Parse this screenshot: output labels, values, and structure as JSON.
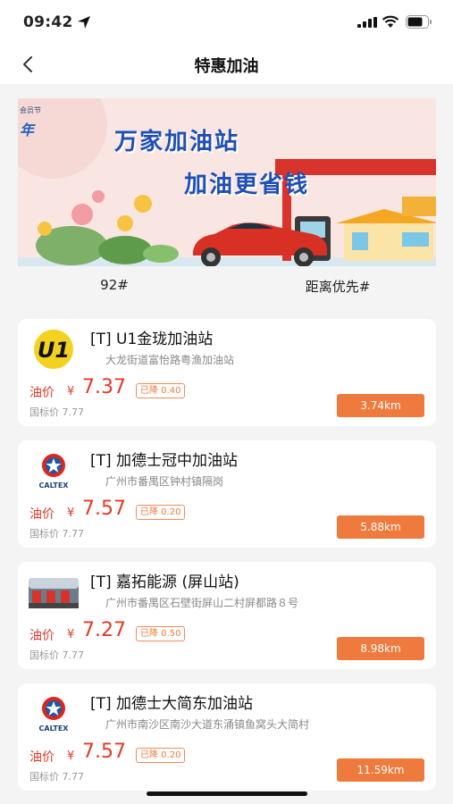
{
  "status_bar": {
    "time": "09:42"
  },
  "nav": {
    "title": "特惠加油"
  },
  "banner": {
    "corner_text": "会员节",
    "corner_mark": "年",
    "line1": "万家加油站",
    "line2": "加油更省钱"
  },
  "filters": {
    "fuel_type": "92#",
    "sort": "距离优先#"
  },
  "labels": {
    "price_label": "油价",
    "currency": "¥"
  },
  "stations": [
    {
      "name": "[T] U1金珑加油站",
      "address": "大龙街道富怡路粤渔加油站",
      "price": "7.37",
      "drop": "已降 0.40",
      "std_price": "国标价 7.77",
      "distance": "3.74km",
      "logo": "u1-logo"
    },
    {
      "name": "[T] 加德士冠中加油站",
      "address": "广州市番禺区钟村镇隔岗",
      "price": "7.57",
      "drop": "已降 0.20",
      "std_price": "国标价 7.77",
      "distance": "5.88km",
      "logo": "caltex-logo"
    },
    {
      "name": "[T] 嘉拓能源 (屏山站)",
      "address": "广州市番禺区石壁街屏山二村屏都路８号",
      "price": "7.27",
      "drop": "已降 0.50",
      "std_price": "国标价 7.77",
      "distance": "8.98km",
      "logo": "station-photo"
    },
    {
      "name": "[T] 加德士大简东加油站",
      "address": "广州市南沙区南沙大道东涌镇鱼窝头大简村",
      "price": "7.57",
      "drop": "已降 0.20",
      "std_price": "国标价 7.77",
      "distance": "11.59km",
      "logo": "caltex-logo"
    }
  ],
  "colors": {
    "accent": "#ef7a3d",
    "price": "#e23a2a",
    "banner_text": "#1f4fb5"
  },
  "icons": {
    "location": "location-arrow-icon",
    "signal": "signal-icon",
    "wifi": "wifi-icon",
    "battery": "battery-icon",
    "back": "chevron-left-icon"
  }
}
